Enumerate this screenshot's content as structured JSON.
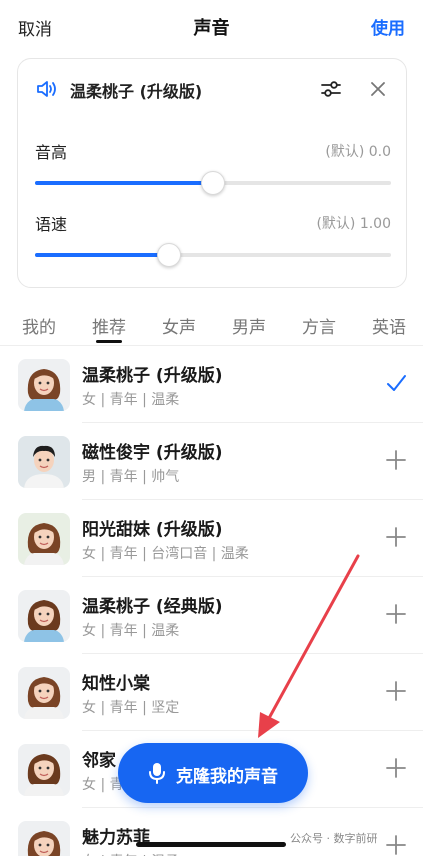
{
  "topbar": {
    "cancel_label": "取消",
    "title": "声音",
    "use_label": "使用"
  },
  "current_voice": {
    "name": "温柔桃子 (升级版)",
    "pitch": {
      "label": "音高",
      "value_text": "(默认) 0.0",
      "position": 0.5
    },
    "speed": {
      "label": "语速",
      "value_text": "(默认) 1.00",
      "position": 0.375
    }
  },
  "tabs": [
    "我的",
    "推荐",
    "女声",
    "男声",
    "方言",
    "英语"
  ],
  "active_tab": 1,
  "voices": [
    {
      "name": "温柔桃子 (升级版)",
      "tags": "女 | 青年 | 温柔",
      "selected": true,
      "avatar": "female"
    },
    {
      "name": "磁性俊宇 (升级版)",
      "tags": "男 | 青年 | 帅气",
      "selected": false,
      "avatar": "male"
    },
    {
      "name": "阳光甜妹 (升级版)",
      "tags": "女 | 青年 | 台湾口音 | 温柔",
      "selected": false,
      "avatar": "female"
    },
    {
      "name": "温柔桃子 (经典版)",
      "tags": "女 | 青年 | 温柔",
      "selected": false,
      "avatar": "female"
    },
    {
      "name": "知性小棠",
      "tags": "女 | 青年 | 坚定",
      "selected": false,
      "avatar": "female"
    },
    {
      "name": "邻家",
      "tags": "女 | 青",
      "selected": false,
      "avatar": "female"
    },
    {
      "name": "魅力苏菲",
      "tags": "女 | 青年 | 温柔",
      "selected": false,
      "avatar": "female"
    }
  ],
  "clone_button": {
    "label": "克隆我的声音"
  },
  "watermark": "公众号 · 数字前研",
  "colors": {
    "accent": "#1a6dff",
    "arrow": "#e8404a"
  }
}
